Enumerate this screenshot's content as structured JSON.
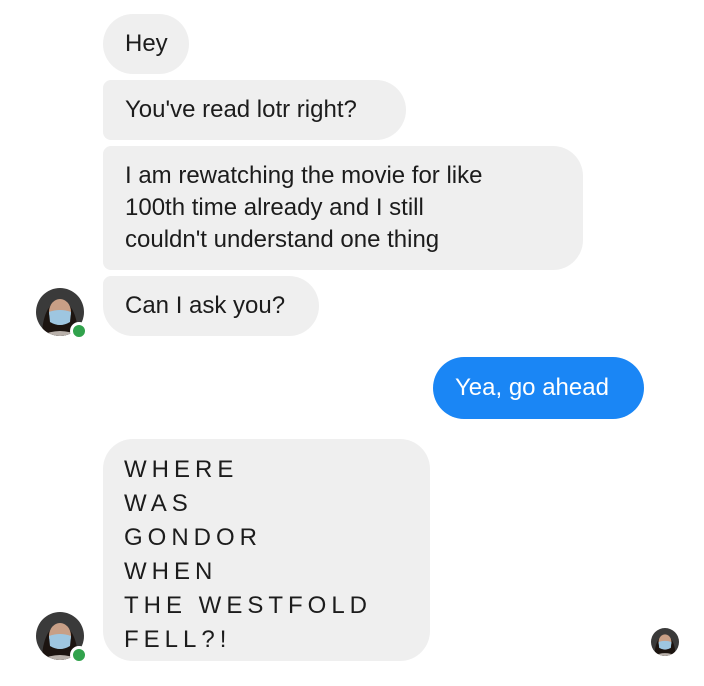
{
  "conversation": {
    "messages": [
      {
        "sender": "contact",
        "text": "Hey"
      },
      {
        "sender": "contact",
        "text": "You've read lotr right?"
      },
      {
        "sender": "contact",
        "text": "I am rewatching the movie for like\n100th time already and I still\ncouldn't understand one thing"
      },
      {
        "sender": "contact",
        "text": "Can I ask you?"
      },
      {
        "sender": "me",
        "text": "Yea, go ahead"
      },
      {
        "sender": "contact",
        "text": "WHERE\nWAS\nGONDOR\nWHEN\nTHE  WESTFOLD\nFELL?!"
      }
    ],
    "contact_status": "online"
  },
  "colors": {
    "incoming_bubble": "#efefef",
    "outgoing_bubble": "#1a86f5",
    "online_dot": "#31a24c"
  },
  "icons": {
    "avatar": "contact-avatar-icon",
    "online": "online-status-dot",
    "seen": "read-receipt-avatar-icon"
  }
}
